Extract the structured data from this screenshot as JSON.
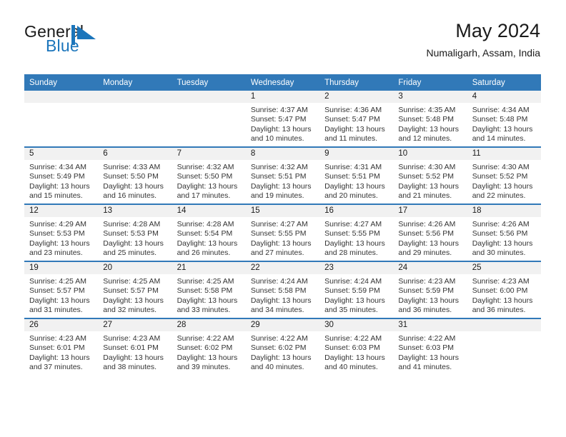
{
  "brand": {
    "name_part1": "General",
    "name_part2": "Blue",
    "mark_icon": "blue-triangle-flag-icon",
    "accent_color": "#1b75bb"
  },
  "header": {
    "title": "May 2024",
    "subtitle": "Numaligarh, Assam, India"
  },
  "colors": {
    "header_bar": "#3179b8",
    "row_divider": "#3179b8",
    "daynum_band": "#f1f1f1",
    "text": "#333333"
  },
  "weekday_headers": [
    "Sunday",
    "Monday",
    "Tuesday",
    "Wednesday",
    "Thursday",
    "Friday",
    "Saturday"
  ],
  "labels": {
    "sunrise_prefix": "Sunrise:",
    "sunset_prefix": "Sunset:",
    "daylight_prefix": "Daylight:"
  },
  "weeks": [
    [
      {
        "day": "",
        "blank": true,
        "sunrise": "",
        "sunset": "",
        "daylight_line1": "",
        "daylight_line2": ""
      },
      {
        "day": "",
        "blank": true,
        "sunrise": "",
        "sunset": "",
        "daylight_line1": "",
        "daylight_line2": ""
      },
      {
        "day": "",
        "blank": true,
        "sunrise": "",
        "sunset": "",
        "daylight_line1": "",
        "daylight_line2": ""
      },
      {
        "day": "1",
        "blank": false,
        "sunrise": "Sunrise: 4:37 AM",
        "sunset": "Sunset: 5:47 PM",
        "daylight_line1": "Daylight: 13 hours",
        "daylight_line2": "and 10 minutes."
      },
      {
        "day": "2",
        "blank": false,
        "sunrise": "Sunrise: 4:36 AM",
        "sunset": "Sunset: 5:47 PM",
        "daylight_line1": "Daylight: 13 hours",
        "daylight_line2": "and 11 minutes."
      },
      {
        "day": "3",
        "blank": false,
        "sunrise": "Sunrise: 4:35 AM",
        "sunset": "Sunset: 5:48 PM",
        "daylight_line1": "Daylight: 13 hours",
        "daylight_line2": "and 12 minutes."
      },
      {
        "day": "4",
        "blank": false,
        "sunrise": "Sunrise: 4:34 AM",
        "sunset": "Sunset: 5:48 PM",
        "daylight_line1": "Daylight: 13 hours",
        "daylight_line2": "and 14 minutes."
      }
    ],
    [
      {
        "day": "5",
        "blank": false,
        "sunrise": "Sunrise: 4:34 AM",
        "sunset": "Sunset: 5:49 PM",
        "daylight_line1": "Daylight: 13 hours",
        "daylight_line2": "and 15 minutes."
      },
      {
        "day": "6",
        "blank": false,
        "sunrise": "Sunrise: 4:33 AM",
        "sunset": "Sunset: 5:50 PM",
        "daylight_line1": "Daylight: 13 hours",
        "daylight_line2": "and 16 minutes."
      },
      {
        "day": "7",
        "blank": false,
        "sunrise": "Sunrise: 4:32 AM",
        "sunset": "Sunset: 5:50 PM",
        "daylight_line1": "Daylight: 13 hours",
        "daylight_line2": "and 17 minutes."
      },
      {
        "day": "8",
        "blank": false,
        "sunrise": "Sunrise: 4:32 AM",
        "sunset": "Sunset: 5:51 PM",
        "daylight_line1": "Daylight: 13 hours",
        "daylight_line2": "and 19 minutes."
      },
      {
        "day": "9",
        "blank": false,
        "sunrise": "Sunrise: 4:31 AM",
        "sunset": "Sunset: 5:51 PM",
        "daylight_line1": "Daylight: 13 hours",
        "daylight_line2": "and 20 minutes."
      },
      {
        "day": "10",
        "blank": false,
        "sunrise": "Sunrise: 4:30 AM",
        "sunset": "Sunset: 5:52 PM",
        "daylight_line1": "Daylight: 13 hours",
        "daylight_line2": "and 21 minutes."
      },
      {
        "day": "11",
        "blank": false,
        "sunrise": "Sunrise: 4:30 AM",
        "sunset": "Sunset: 5:52 PM",
        "daylight_line1": "Daylight: 13 hours",
        "daylight_line2": "and 22 minutes."
      }
    ],
    [
      {
        "day": "12",
        "blank": false,
        "sunrise": "Sunrise: 4:29 AM",
        "sunset": "Sunset: 5:53 PM",
        "daylight_line1": "Daylight: 13 hours",
        "daylight_line2": "and 23 minutes."
      },
      {
        "day": "13",
        "blank": false,
        "sunrise": "Sunrise: 4:28 AM",
        "sunset": "Sunset: 5:53 PM",
        "daylight_line1": "Daylight: 13 hours",
        "daylight_line2": "and 25 minutes."
      },
      {
        "day": "14",
        "blank": false,
        "sunrise": "Sunrise: 4:28 AM",
        "sunset": "Sunset: 5:54 PM",
        "daylight_line1": "Daylight: 13 hours",
        "daylight_line2": "and 26 minutes."
      },
      {
        "day": "15",
        "blank": false,
        "sunrise": "Sunrise: 4:27 AM",
        "sunset": "Sunset: 5:55 PM",
        "daylight_line1": "Daylight: 13 hours",
        "daylight_line2": "and 27 minutes."
      },
      {
        "day": "16",
        "blank": false,
        "sunrise": "Sunrise: 4:27 AM",
        "sunset": "Sunset: 5:55 PM",
        "daylight_line1": "Daylight: 13 hours",
        "daylight_line2": "and 28 minutes."
      },
      {
        "day": "17",
        "blank": false,
        "sunrise": "Sunrise: 4:26 AM",
        "sunset": "Sunset: 5:56 PM",
        "daylight_line1": "Daylight: 13 hours",
        "daylight_line2": "and 29 minutes."
      },
      {
        "day": "18",
        "blank": false,
        "sunrise": "Sunrise: 4:26 AM",
        "sunset": "Sunset: 5:56 PM",
        "daylight_line1": "Daylight: 13 hours",
        "daylight_line2": "and 30 minutes."
      }
    ],
    [
      {
        "day": "19",
        "blank": false,
        "sunrise": "Sunrise: 4:25 AM",
        "sunset": "Sunset: 5:57 PM",
        "daylight_line1": "Daylight: 13 hours",
        "daylight_line2": "and 31 minutes."
      },
      {
        "day": "20",
        "blank": false,
        "sunrise": "Sunrise: 4:25 AM",
        "sunset": "Sunset: 5:57 PM",
        "daylight_line1": "Daylight: 13 hours",
        "daylight_line2": "and 32 minutes."
      },
      {
        "day": "21",
        "blank": false,
        "sunrise": "Sunrise: 4:25 AM",
        "sunset": "Sunset: 5:58 PM",
        "daylight_line1": "Daylight: 13 hours",
        "daylight_line2": "and 33 minutes."
      },
      {
        "day": "22",
        "blank": false,
        "sunrise": "Sunrise: 4:24 AM",
        "sunset": "Sunset: 5:58 PM",
        "daylight_line1": "Daylight: 13 hours",
        "daylight_line2": "and 34 minutes."
      },
      {
        "day": "23",
        "blank": false,
        "sunrise": "Sunrise: 4:24 AM",
        "sunset": "Sunset: 5:59 PM",
        "daylight_line1": "Daylight: 13 hours",
        "daylight_line2": "and 35 minutes."
      },
      {
        "day": "24",
        "blank": false,
        "sunrise": "Sunrise: 4:23 AM",
        "sunset": "Sunset: 5:59 PM",
        "daylight_line1": "Daylight: 13 hours",
        "daylight_line2": "and 36 minutes."
      },
      {
        "day": "25",
        "blank": false,
        "sunrise": "Sunrise: 4:23 AM",
        "sunset": "Sunset: 6:00 PM",
        "daylight_line1": "Daylight: 13 hours",
        "daylight_line2": "and 36 minutes."
      }
    ],
    [
      {
        "day": "26",
        "blank": false,
        "sunrise": "Sunrise: 4:23 AM",
        "sunset": "Sunset: 6:01 PM",
        "daylight_line1": "Daylight: 13 hours",
        "daylight_line2": "and 37 minutes."
      },
      {
        "day": "27",
        "blank": false,
        "sunrise": "Sunrise: 4:23 AM",
        "sunset": "Sunset: 6:01 PM",
        "daylight_line1": "Daylight: 13 hours",
        "daylight_line2": "and 38 minutes."
      },
      {
        "day": "28",
        "blank": false,
        "sunrise": "Sunrise: 4:22 AM",
        "sunset": "Sunset: 6:02 PM",
        "daylight_line1": "Daylight: 13 hours",
        "daylight_line2": "and 39 minutes."
      },
      {
        "day": "29",
        "blank": false,
        "sunrise": "Sunrise: 4:22 AM",
        "sunset": "Sunset: 6:02 PM",
        "daylight_line1": "Daylight: 13 hours",
        "daylight_line2": "and 40 minutes."
      },
      {
        "day": "30",
        "blank": false,
        "sunrise": "Sunrise: 4:22 AM",
        "sunset": "Sunset: 6:03 PM",
        "daylight_line1": "Daylight: 13 hours",
        "daylight_line2": "and 40 minutes."
      },
      {
        "day": "31",
        "blank": false,
        "sunrise": "Sunrise: 4:22 AM",
        "sunset": "Sunset: 6:03 PM",
        "daylight_line1": "Daylight: 13 hours",
        "daylight_line2": "and 41 minutes."
      },
      {
        "day": "",
        "blank": true,
        "sunrise": "",
        "sunset": "",
        "daylight_line1": "",
        "daylight_line2": ""
      }
    ]
  ]
}
